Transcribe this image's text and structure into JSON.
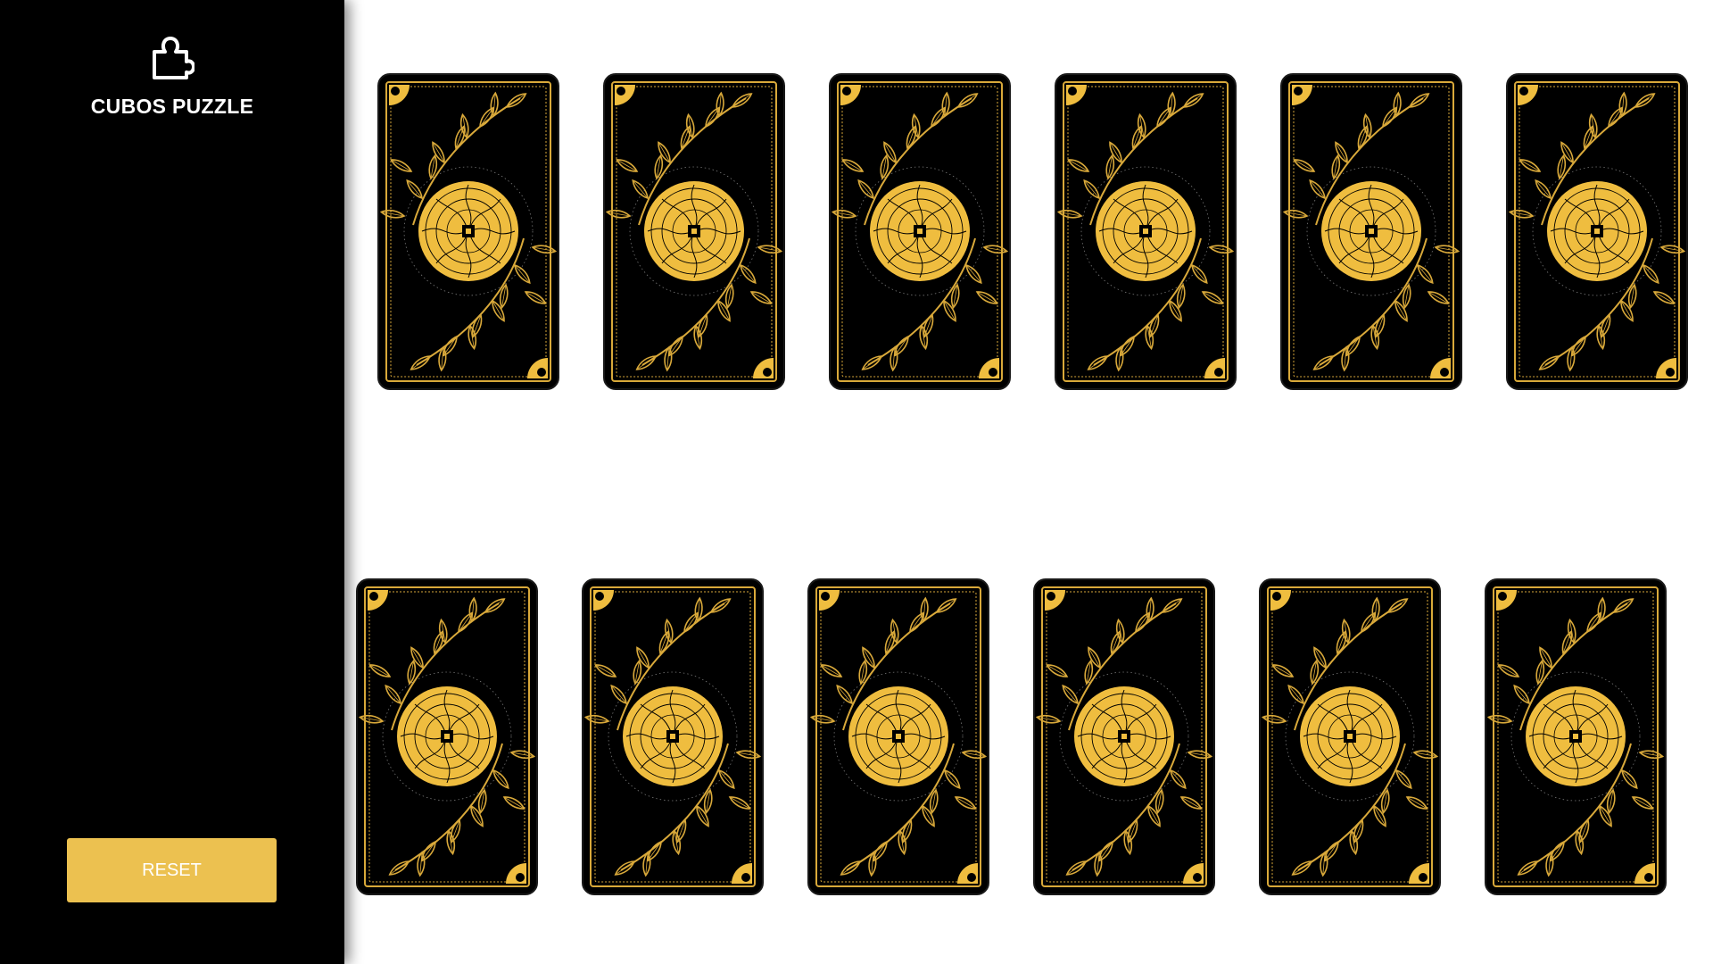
{
  "app": {
    "title": "CUBOS PUZZLE",
    "logo_icon": "puzzle-piece-icon"
  },
  "controls": {
    "reset_label": "RESET"
  },
  "board": {
    "card_back_colors": {
      "base": "#000000",
      "gold": "#EFBD3F",
      "line": "#D9A93A"
    },
    "cards": [
      {
        "id": 1,
        "state": "face-down"
      },
      {
        "id": 2,
        "state": "face-down"
      },
      {
        "id": 3,
        "state": "face-down"
      },
      {
        "id": 4,
        "state": "face-down"
      },
      {
        "id": 5,
        "state": "face-down"
      },
      {
        "id": 6,
        "state": "face-down"
      },
      {
        "id": 7,
        "state": "face-down"
      },
      {
        "id": 8,
        "state": "face-down"
      },
      {
        "id": 9,
        "state": "face-down"
      },
      {
        "id": 10,
        "state": "face-down"
      },
      {
        "id": 11,
        "state": "face-down"
      },
      {
        "id": 12,
        "state": "face-down"
      }
    ]
  }
}
